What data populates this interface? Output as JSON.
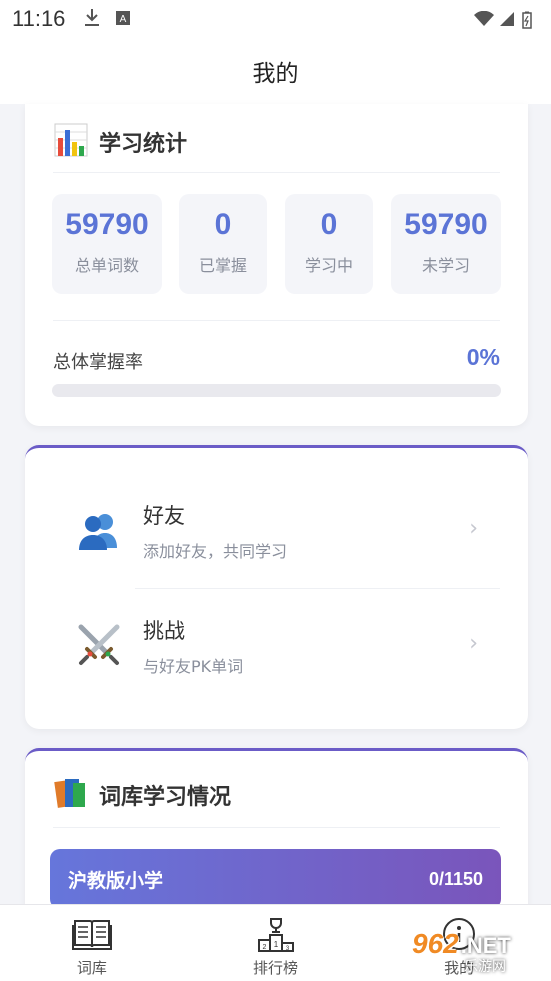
{
  "status_bar": {
    "time": "11:16"
  },
  "header": {
    "title": "我的"
  },
  "stats": {
    "title": "学习统计",
    "items": [
      {
        "value": "59790",
        "label": "总单词数"
      },
      {
        "value": "0",
        "label": "已掌握"
      },
      {
        "value": "0",
        "label": "学习中"
      },
      {
        "value": "59790",
        "label": "未学习"
      }
    ],
    "mastery_label": "总体掌握率",
    "mastery_value": "0%",
    "mastery_fraction": 0
  },
  "social": {
    "items": [
      {
        "title": "好友",
        "subtitle": "添加好友，共同学习"
      },
      {
        "title": "挑战",
        "subtitle": "与好友PK单词"
      }
    ]
  },
  "library": {
    "title": "词库学习情况",
    "books": [
      {
        "name": "沪教版小学",
        "progress": "0/1150"
      }
    ]
  },
  "bottom_nav": {
    "items": [
      {
        "label": "词库"
      },
      {
        "label": "排行榜"
      },
      {
        "label": "我的"
      }
    ]
  },
  "watermark": {
    "logo": "962",
    "domain": ".NET",
    "sub": "乐游网"
  },
  "colors": {
    "accent": "#5b74d6",
    "gradient_start": "#6676db",
    "gradient_end": "#7a55bb"
  },
  "icons": {
    "stats": "bar-chart-icon",
    "friends": "people-icon",
    "challenge": "crossed-swords-icon",
    "library": "books-icon"
  }
}
